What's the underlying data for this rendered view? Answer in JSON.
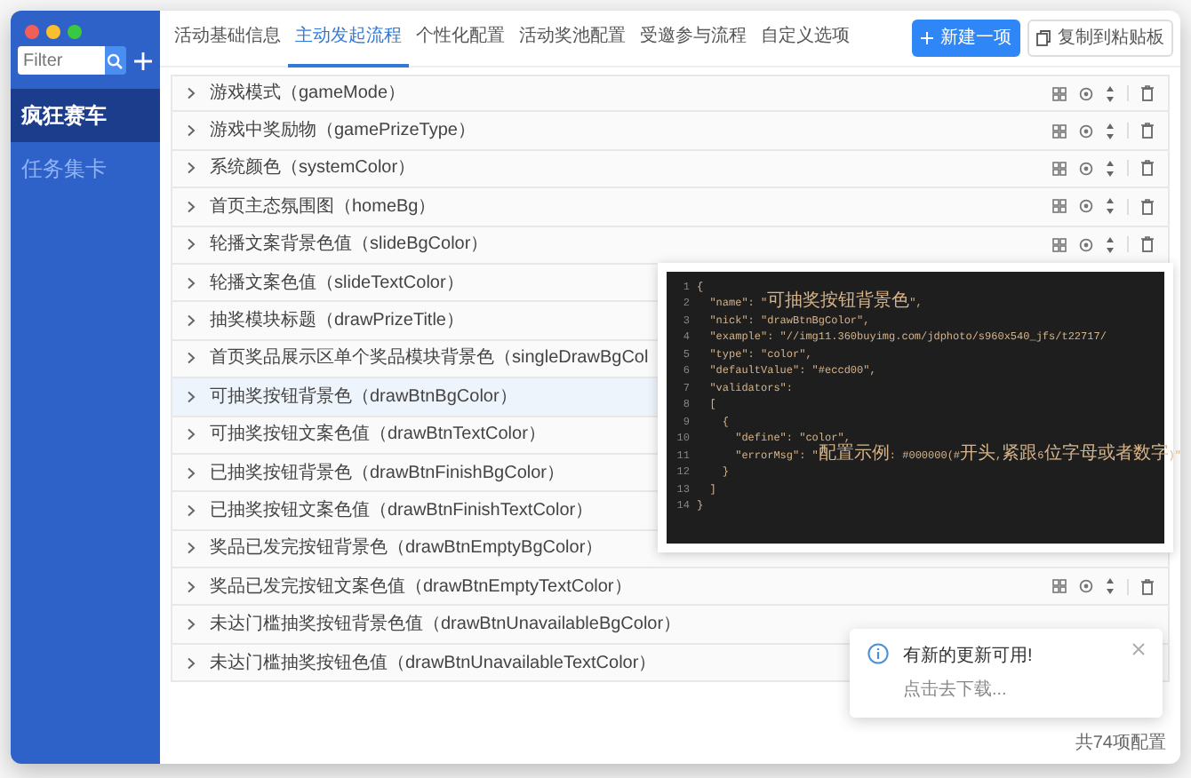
{
  "sidebar": {
    "filter": {
      "placeholder": "Filter"
    },
    "items": [
      {
        "label": "疯狂赛车",
        "selected": true
      },
      {
        "label": "任务集卡",
        "selected": false
      }
    ]
  },
  "tabs": [
    {
      "label": "活动基础信息",
      "selected": false
    },
    {
      "label": "主动发起流程",
      "selected": true
    },
    {
      "label": "个性化配置",
      "selected": false
    },
    {
      "label": "活动奖池配置",
      "selected": false
    },
    {
      "label": "受邀参与流程",
      "selected": false
    },
    {
      "label": "自定义选项",
      "selected": false
    }
  ],
  "buttons": [
    {
      "label": "新建一项",
      "kind": "primary"
    },
    {
      "label": "复制到粘贴板",
      "kind": "copy"
    }
  ],
  "rows": [
    {
      "label": "游戏模式（gameMode）",
      "selected": false
    },
    {
      "label": "游戏中奖励物（gamePrizeType）",
      "selected": false
    },
    {
      "label": "系统颜色（systemColor）",
      "selected": false
    },
    {
      "label": "首页主态氛围图（homeBg）",
      "selected": false
    },
    {
      "label": "轮播文案背景色值（slideBgColor）",
      "selected": false
    },
    {
      "label": "轮播文案色值（slideTextColor）",
      "selected": false
    },
    {
      "label": "抽奖模块标题（drawPrizeTitle）",
      "selected": false
    },
    {
      "label": "首页奖品展示区单个奖品模块背景色（singleDrawBgCol",
      "selected": false
    },
    {
      "label": "可抽奖按钮背景色（drawBtnBgColor）",
      "selected": true
    },
    {
      "label": "可抽奖按钮文案色值（drawBtnTextColor）",
      "selected": false
    },
    {
      "label": "已抽奖按钮背景色（drawBtnFinishBgColor）",
      "selected": false
    },
    {
      "label": "已抽奖按钮文案色值（drawBtnFinishTextColor）",
      "selected": false
    },
    {
      "label": "奖品已发完按钮背景色（drawBtnEmptyBgColor）",
      "selected": false
    },
    {
      "label": "奖品已发完按钮文案色值（drawBtnEmptyTextColor）",
      "selected": false
    },
    {
      "label": "未达门槛抽奖按钮背景色值（drawBtnUnavailableBgColor）",
      "selected": false
    },
    {
      "label": "未达门槛抽奖按钮色值（drawBtnUnavailableTextColor）",
      "selected": false
    }
  ],
  "code_popup": {
    "lines": [
      {
        "number": "1",
        "text": "{"
      },
      {
        "number": "2",
        "text": "  \"name\": \"可抽奖按钮背景色\","
      },
      {
        "number": "3",
        "text": "  \"nick\": \"drawBtnBgColor\","
      },
      {
        "number": "4",
        "text": "  \"example\": \"//img11.360buyimg.com/jdphoto/s960x540_jfs/t22717/"
      },
      {
        "number": "5",
        "text": "  \"type\": \"color\","
      },
      {
        "number": "6",
        "text": "  \"defaultValue\": \"#eccd00\","
      },
      {
        "number": "7",
        "text": "  \"validators\":"
      },
      {
        "number": "8",
        "text": "  ["
      },
      {
        "number": "9",
        "text": "    {"
      },
      {
        "number": "10",
        "text": "      \"define\": \"color\","
      },
      {
        "number": "11",
        "text": "      \"errorMsg\": \"配置示例: #000000(#开头,紧跟6位字母或者数字)\""
      },
      {
        "number": "12",
        "text": "    }"
      },
      {
        "number": "13",
        "text": "  ]"
      },
      {
        "number": "14",
        "text": "}"
      }
    ]
  },
  "toast": {
    "title": "有新的更新可用!",
    "message": "点击去下载..."
  },
  "footer": "共74项配置"
}
